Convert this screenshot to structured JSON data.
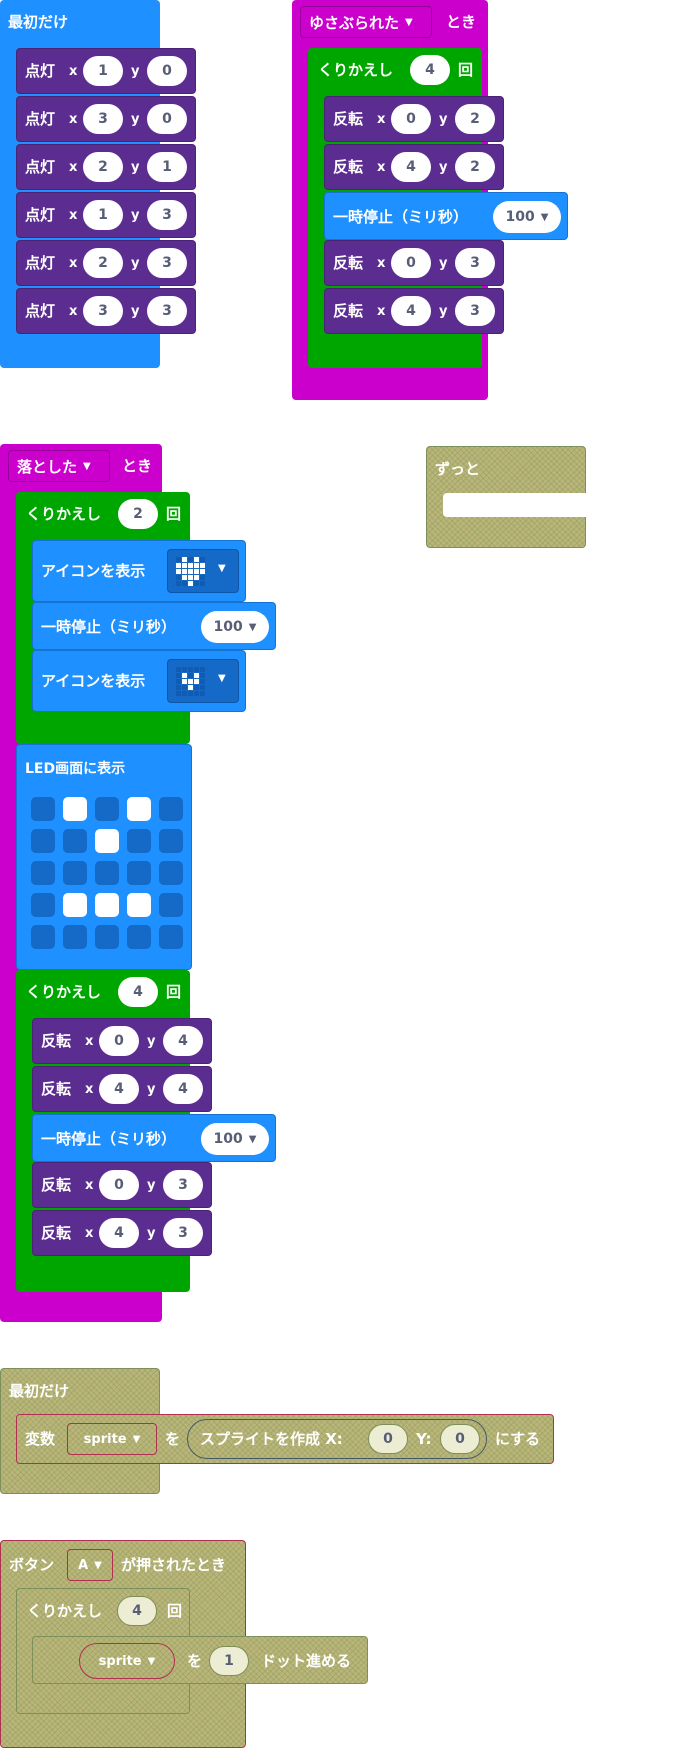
{
  "palette": {
    "basic_blue": "#1e90ff",
    "led_purple": "#5c2d91",
    "loop_green": "#00a600",
    "input_magenta": "#cc00cc",
    "disabled_olive": "#bcb57a"
  },
  "stack1": {
    "hat_label": "最初だけ",
    "rows": [
      {
        "label": "点灯",
        "x": "1",
        "y": "0"
      },
      {
        "label": "点灯",
        "x": "3",
        "y": "0"
      },
      {
        "label": "点灯",
        "x": "2",
        "y": "1"
      },
      {
        "label": "点灯",
        "x": "1",
        "y": "3"
      },
      {
        "label": "点灯",
        "x": "2",
        "y": "3"
      },
      {
        "label": "点灯",
        "x": "3",
        "y": "3"
      }
    ],
    "x_label": "x",
    "y_label": "y"
  },
  "stack2": {
    "event_dropdown": "ゆさぶられた",
    "event_suffix": "とき",
    "repeat_label": "くりかえし",
    "repeat_count": "4",
    "repeat_suffix": "回",
    "toggle1": {
      "label": "反転",
      "x": "0",
      "y": "2"
    },
    "toggle2": {
      "label": "反転",
      "x": "4",
      "y": "2"
    },
    "pause_label": "一時停止（ミリ秒）",
    "pause_value": "100",
    "toggle3": {
      "label": "反転",
      "x": "0",
      "y": "3"
    },
    "toggle4": {
      "label": "反転",
      "x": "4",
      "y": "3"
    },
    "x_label": "x",
    "y_label": "y"
  },
  "stack3": {
    "event_dropdown": "落とした",
    "event_suffix": "とき",
    "repeat1_label": "くりかえし",
    "repeat1_count": "2",
    "repeat1_suffix": "回",
    "show_icon1_label": "アイコンを表示",
    "icon1_name": "heart-icon",
    "pause1_label": "一時停止（ミリ秒）",
    "pause1_value": "100",
    "show_icon2_label": "アイコンを表示",
    "icon2_name": "small-heart-icon",
    "led_label": "LED画面に表示",
    "led_rows": [
      [
        0,
        1,
        0,
        1,
        0
      ],
      [
        0,
        0,
        1,
        0,
        0
      ],
      [
        0,
        0,
        0,
        0,
        0
      ],
      [
        0,
        1,
        1,
        1,
        0
      ],
      [
        0,
        0,
        0,
        0,
        0
      ]
    ],
    "repeat2_label": "くりかえし",
    "repeat2_count": "4",
    "repeat2_suffix": "回",
    "toggle1": {
      "label": "反転",
      "x": "0",
      "y": "4"
    },
    "toggle2": {
      "label": "反転",
      "x": "4",
      "y": "4"
    },
    "pause2_label": "一時停止（ミリ秒）",
    "pause2_value": "100",
    "toggle3": {
      "label": "反転",
      "x": "0",
      "y": "3"
    },
    "toggle4": {
      "label": "反転",
      "x": "4",
      "y": "3"
    },
    "x_label": "x",
    "y_label": "y"
  },
  "forever_block": {
    "label": "ずっと"
  },
  "stack4": {
    "hat_label": "最初だけ",
    "var_label": "変数",
    "var_name": "sprite",
    "wo_label": "を",
    "create_label": "スプライトを作成 X:",
    "x_value": "0",
    "y_label": "Y:",
    "y_value": "0",
    "suffix": "にする"
  },
  "stack5": {
    "event_prefix": "ボタン",
    "button_value": "A",
    "event_suffix": "が押されたとき",
    "repeat_label": "くりかえし",
    "repeat_count": "4",
    "repeat_suffix": "回",
    "sprite_name": "sprite",
    "wo_label": "を",
    "move_value": "1",
    "move_suffix": "ドット進める"
  }
}
